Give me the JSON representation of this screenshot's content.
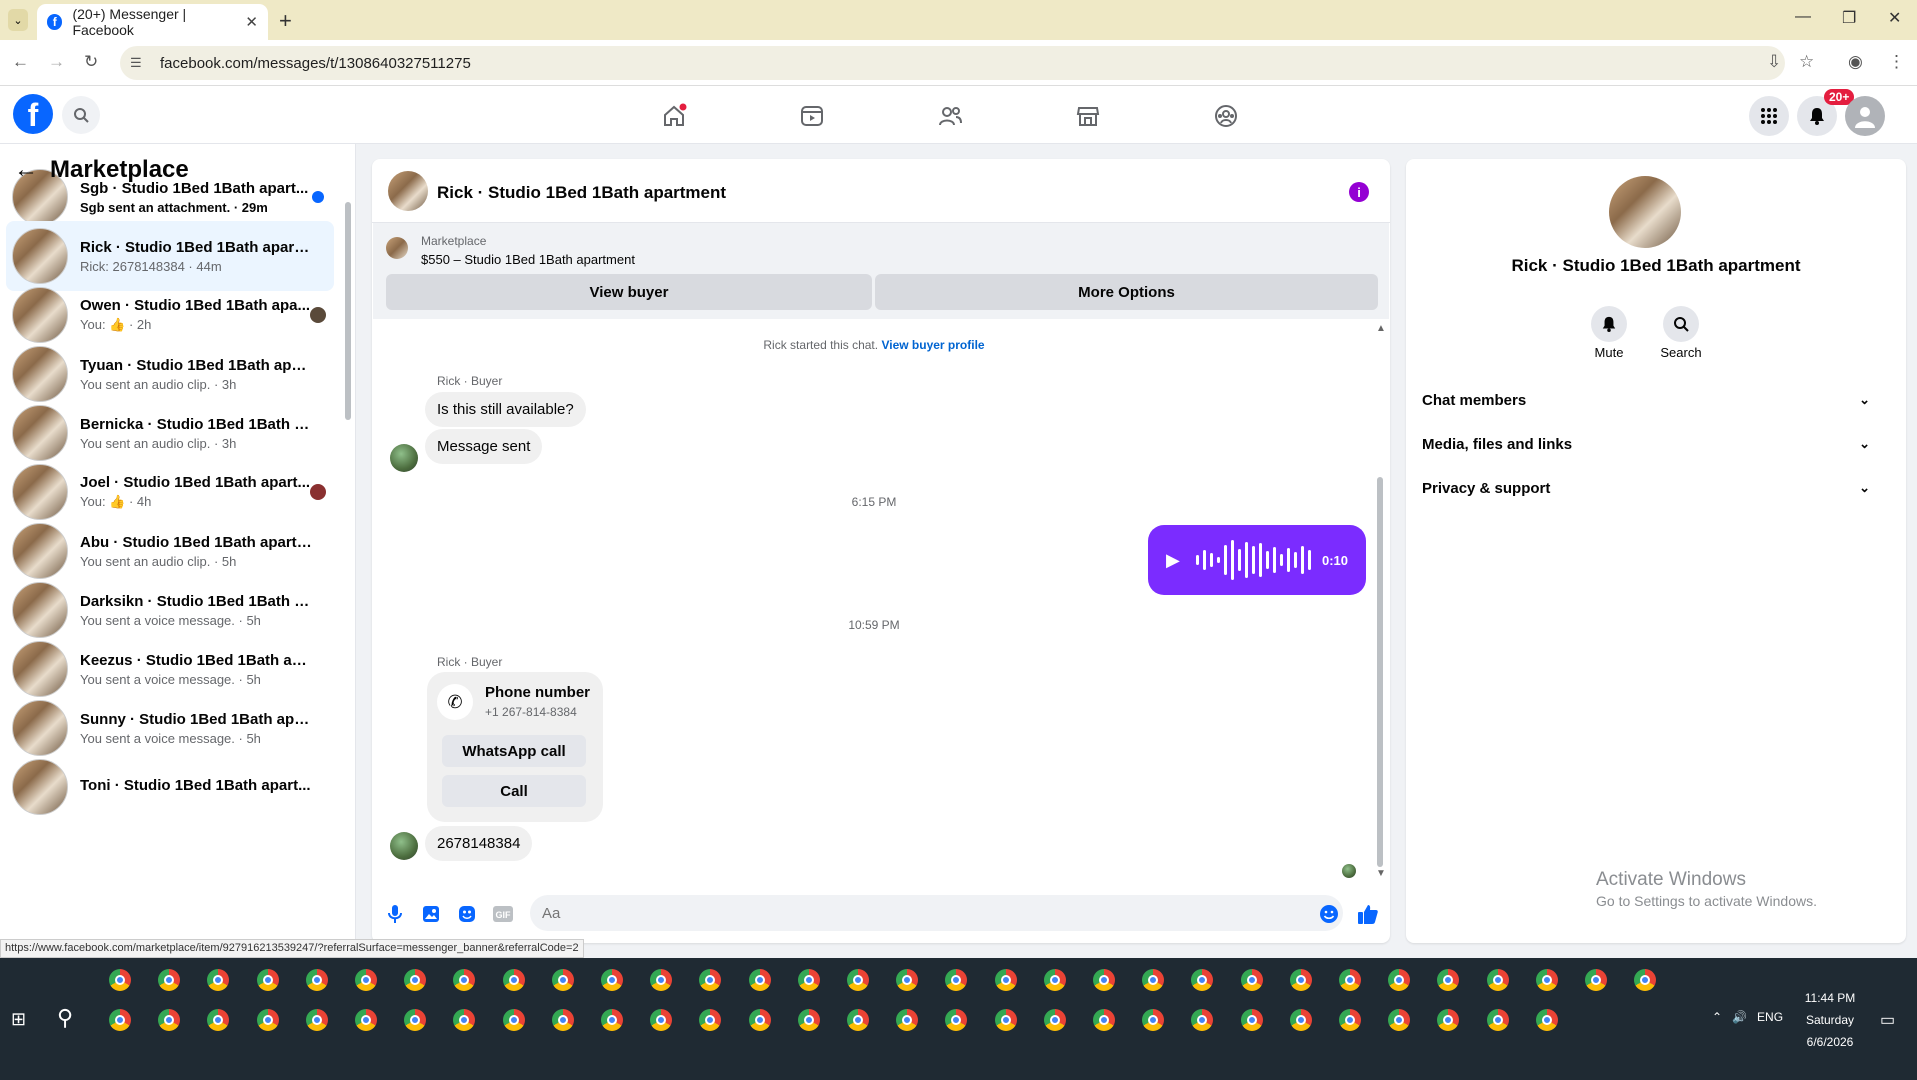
{
  "browser": {
    "tab_title": "(20+) Messenger | Facebook",
    "url": "facebook.com/messages/t/1308640327511275",
    "status_url": "https://www.facebook.com/marketplace/item/927916213539247/?referralSurface=messenger_banner&referralCode=2"
  },
  "fb": {
    "notification_badge": "20+"
  },
  "sidebar": {
    "title": "Marketplace",
    "conversations": [
      {
        "name": "Sgb · Studio 1Bed 1Bath apart...",
        "preview": "Sgb sent an attachment. · 29m",
        "unread": true
      },
      {
        "name": "Rick · Studio 1Bed 1Bath apartm...",
        "preview": "Rick: 2678148384 · 44m",
        "selected": true
      },
      {
        "name": "Owen · Studio 1Bed 1Bath apa...",
        "preview": "You: 👍 · 2h"
      },
      {
        "name": "Tyuan · Studio 1Bed 1Bath apart...",
        "preview": "You sent an audio clip. · 3h"
      },
      {
        "name": "Bernicka · Studio 1Bed 1Bath apa...",
        "preview": "You sent an audio clip. · 3h"
      },
      {
        "name": "Joel · Studio 1Bed 1Bath apart...",
        "preview": "You: 👍 · 4h"
      },
      {
        "name": "Abu · Studio 1Bed 1Bath apartm...",
        "preview": "You sent an audio clip. · 5h"
      },
      {
        "name": "Darksikn · Studio 1Bed 1Bath apa...",
        "preview": "You sent a voice message. · 5h"
      },
      {
        "name": "Keezus · Studio 1Bed 1Bath apart...",
        "preview": "You sent a voice message. · 5h"
      },
      {
        "name": "Sunny · Studio 1Bed 1Bath apart...",
        "preview": "You sent a voice message. · 5h"
      },
      {
        "name": "Toni · Studio 1Bed 1Bath apart...",
        "preview": ""
      }
    ]
  },
  "chat": {
    "title": "Rick · Studio 1Bed 1Bath apartment",
    "marketplace_label": "Marketplace",
    "listing": "$550 – Studio 1Bed 1Bath apartment",
    "view_buyer": "View buyer",
    "more_options": "More Options",
    "started_text": "Rick started this chat.",
    "view_buyer_profile": "View buyer profile",
    "sender_label": "Rick · Buyer",
    "msg1": "Is this still available?",
    "msg2": "Message sent",
    "time1": "6:15 PM",
    "audio_duration": "0:10",
    "time2": "10:59 PM",
    "phone_title": "Phone number",
    "phone_number": "+1 267-814-8384",
    "whatsapp_call": "WhatsApp call",
    "call": "Call",
    "msg3": "2678148384",
    "input_placeholder": "Aa"
  },
  "details": {
    "name": "Rick · Studio 1Bed 1Bath apartment",
    "mute": "Mute",
    "search": "Search",
    "sections": [
      "Chat members",
      "Media, files and links",
      "Privacy & support"
    ]
  },
  "watermark": {
    "line1": "Activate Windows",
    "line2": "Go to Settings to activate Windows."
  },
  "taskbar": {
    "time": "11:44 PM",
    "day": "Saturday",
    "date": "6/6/2026",
    "lang": "ENG"
  },
  "colors": {
    "brand": "#0866ff",
    "audio_bubble": "#7b2cff",
    "selected_row": "#ebf5ff"
  }
}
